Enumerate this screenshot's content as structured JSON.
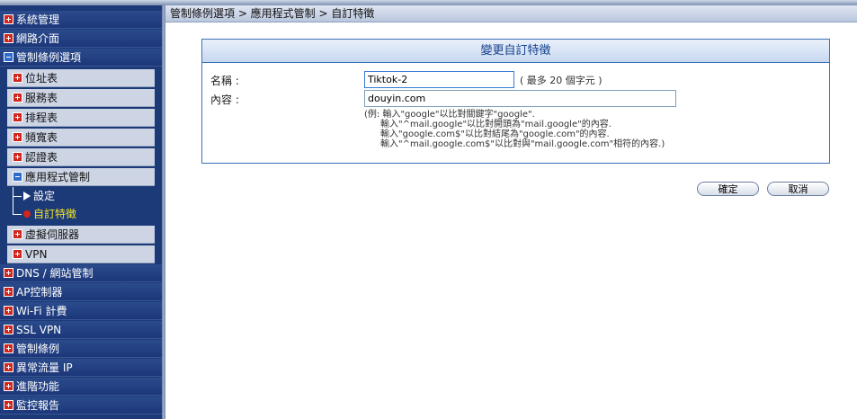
{
  "sidebar": {
    "system_mgmt": "系統管理",
    "network_iface": "網路介面",
    "policy_objects": "管制條例選項",
    "address_table": "位址表",
    "service_table": "服務表",
    "schedule_table": "排程表",
    "bandwidth_table": "頻寬表",
    "cert_table": "認證表",
    "app_control": "應用程式管制",
    "app_settings": "設定",
    "app_custom_sig": "自訂特徵",
    "virtual_server": "虛擬伺服器",
    "vpn": "VPN",
    "dns_web": "DNS / 網站管制",
    "ap_controller": "AP控制器",
    "wifi_billing": "Wi-Fi 計費",
    "ssl_vpn": "SSL VPN",
    "policy": "管制條例",
    "abnormal_ip": "異常流量 IP",
    "advanced": "進階功能",
    "monitor_report": "監控報告"
  },
  "breadcrumb": "管制條例選項 > 應用程式管制 > 自訂特徵",
  "form": {
    "title": "變更自訂特徵",
    "name_label": "名稱 :",
    "name_value": "Tiktok-2",
    "name_hint": "( 最多 20 個字元 )",
    "content_label": "內容 :",
    "content_value": "douyin.com",
    "example_lines": [
      "(例: 輸入\"google\"以比對關鍵字\"google\".",
      "輸入\"^mail.google\"以比對開頭為\"mail.google\"的內容.",
      "輸入\"google.com$\"以比對結尾為\"google.com\"的內容.",
      "輸入\"^mail.google.com$\"以比對與\"mail.google.com\"相符的內容.)"
    ]
  },
  "buttons": {
    "ok": "確定",
    "cancel": "取消"
  }
}
